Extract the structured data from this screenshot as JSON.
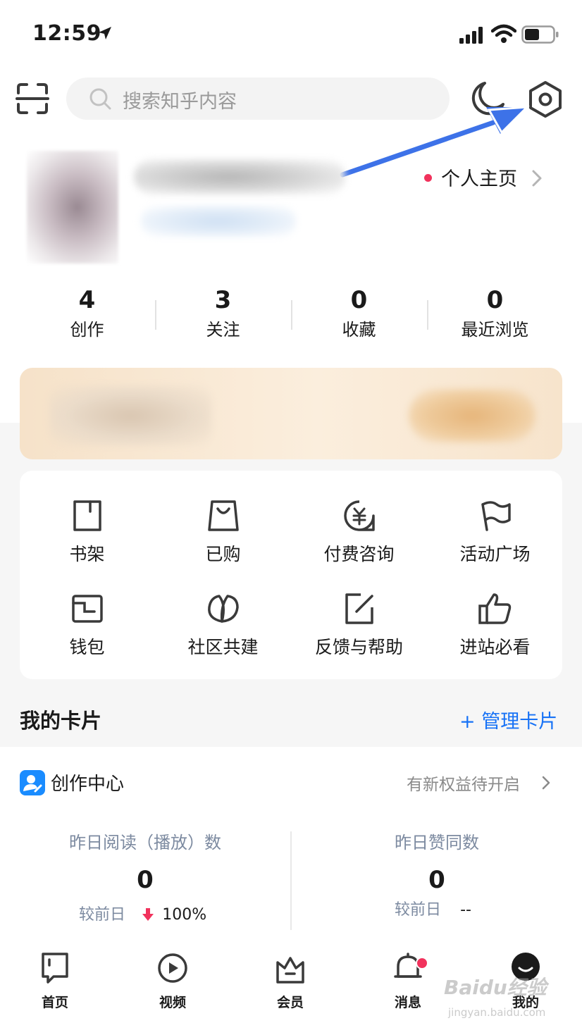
{
  "status_bar": {
    "time": "12:59"
  },
  "search": {
    "placeholder": "搜索知乎内容"
  },
  "profile": {
    "home_link": "个人主页"
  },
  "stats": [
    {
      "value": "4",
      "label": "创作"
    },
    {
      "value": "3",
      "label": "关注"
    },
    {
      "value": "0",
      "label": "收藏"
    },
    {
      "value": "0",
      "label": "最近浏览"
    }
  ],
  "grid": [
    {
      "label": "书架",
      "icon": "bookshelf-icon"
    },
    {
      "label": "已购",
      "icon": "shopping-bag-icon"
    },
    {
      "label": "付费咨询",
      "icon": "paid-consult-icon"
    },
    {
      "label": "活动广场",
      "icon": "flag-icon"
    },
    {
      "label": "钱包",
      "icon": "wallet-icon"
    },
    {
      "label": "社区共建",
      "icon": "leaf-icon"
    },
    {
      "label": "反馈与帮助",
      "icon": "edit-icon"
    },
    {
      "label": "进站必看",
      "icon": "thumbs-up-icon"
    }
  ],
  "cards": {
    "title": "我的卡片",
    "manage": "+ 管理卡片"
  },
  "creator": {
    "title": "创作中心",
    "status": "有新权益待开启",
    "metrics": [
      {
        "label": "昨日阅读（播放）数",
        "value": "0",
        "compare_label": "较前日",
        "compare_value": "100%"
      },
      {
        "label": "昨日赞同数",
        "value": "0",
        "compare_label": "较前日",
        "compare_value": "--"
      }
    ]
  },
  "tabs": [
    {
      "label": "首页",
      "icon": "home-icon"
    },
    {
      "label": "视频",
      "icon": "video-icon"
    },
    {
      "label": "会员",
      "icon": "vip-crown-icon"
    },
    {
      "label": "消息",
      "icon": "bell-icon"
    },
    {
      "label": "我的",
      "icon": "profile-icon"
    }
  ],
  "watermark": {
    "text": "Baidu经验",
    "sub": "jingyan.baidu.com"
  },
  "colors": {
    "accent": "#1772f6",
    "badge": "#f1325c",
    "banner": "#f6e2c9"
  }
}
